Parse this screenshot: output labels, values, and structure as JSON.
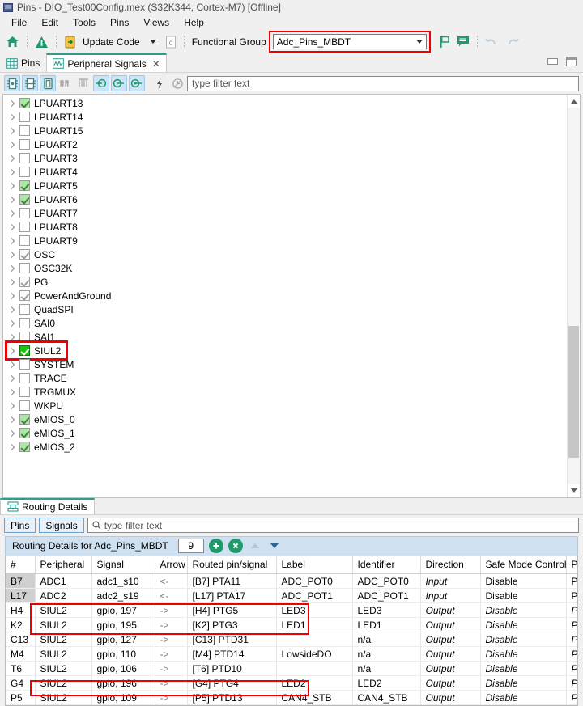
{
  "window": {
    "title": "Pins - DIO_Test00Config.mex (S32K344, Cortex-M7) [Offline]",
    "icon": "window-icon"
  },
  "menubar": {
    "items": [
      "File",
      "Edit",
      "Tools",
      "Pins",
      "Views",
      "Help"
    ]
  },
  "toolbar": {
    "home_icon": "home-icon",
    "warning_icon": "warning-icon",
    "update_code_icon": "update-code-icon",
    "update_code_label": "Update Code",
    "dropdown_caret": "chevron-down-icon",
    "config_icon": "config-c-icon",
    "functional_group_label": "Functional Group",
    "functional_group_value": "Adc_Pins_MBDT",
    "functional_group_arrow": "chevron-down-icon",
    "flag_icon": "flag-icon",
    "note_icon": "note-icon",
    "undo_icon": "undo-icon",
    "redo_icon": "redo-icon",
    "highlight_color": "#ee0000"
  },
  "editor": {
    "tabs": [
      {
        "label": "Pins",
        "icon": "grid-icon",
        "active": false,
        "closable": false
      },
      {
        "label": "Peripheral Signals",
        "icon": "wave-icon",
        "active": true,
        "closable": true
      }
    ],
    "close_glyph": "✕",
    "window_buttons": [
      "minimize-button",
      "maximize-button"
    ]
  },
  "filterbar": {
    "buttons": [
      {
        "name": "show-package-pins-icon",
        "active": true
      },
      {
        "name": "show-chip-pins-icon",
        "active": true
      },
      {
        "name": "show-dip-pins-icon",
        "active": true
      },
      {
        "name": "show-all-signals-icon",
        "active": false
      },
      {
        "name": "show-grouped-signals-icon",
        "active": false
      },
      {
        "name": "routed-in-icon",
        "active": true
      },
      {
        "name": "routed-out-icon",
        "active": true
      },
      {
        "name": "routed-bidir-icon",
        "active": true
      },
      {
        "name": "power-icon",
        "active": false
      },
      {
        "name": "clock-icon",
        "active": false
      }
    ],
    "filter_placeholder": "type filter text"
  },
  "tree": {
    "highlight_color": "#ee0000",
    "highlighted_item": "SIUL2",
    "items": [
      {
        "label": "LPUART13",
        "state": "pale-checked"
      },
      {
        "label": "LPUART14",
        "state": "unchecked"
      },
      {
        "label": "LPUART15",
        "state": "unchecked"
      },
      {
        "label": "LPUART2",
        "state": "unchecked"
      },
      {
        "label": "LPUART3",
        "state": "unchecked"
      },
      {
        "label": "LPUART4",
        "state": "unchecked"
      },
      {
        "label": "LPUART5",
        "state": "pale-checked"
      },
      {
        "label": "LPUART6",
        "state": "pale-checked"
      },
      {
        "label": "LPUART7",
        "state": "unchecked"
      },
      {
        "label": "LPUART8",
        "state": "unchecked"
      },
      {
        "label": "LPUART9",
        "state": "unchecked"
      },
      {
        "label": "OSC",
        "state": "gray-checked"
      },
      {
        "label": "OSC32K",
        "state": "unchecked"
      },
      {
        "label": "PG",
        "state": "gray-checked"
      },
      {
        "label": "PowerAndGround",
        "state": "gray-checked"
      },
      {
        "label": "QuadSPI",
        "state": "unchecked"
      },
      {
        "label": "SAI0",
        "state": "unchecked"
      },
      {
        "label": "SAI1",
        "state": "unchecked"
      },
      {
        "label": "SIUL2",
        "state": "bright-checked"
      },
      {
        "label": "SYSTEM",
        "state": "unchecked"
      },
      {
        "label": "TRACE",
        "state": "unchecked"
      },
      {
        "label": "TRGMUX",
        "state": "unchecked"
      },
      {
        "label": "WKPU",
        "state": "unchecked"
      },
      {
        "label": "eMIOS_0",
        "state": "pale-checked"
      },
      {
        "label": "eMIOS_1",
        "state": "pale-checked"
      },
      {
        "label": "eMIOS_2",
        "state": "pale-checked"
      }
    ]
  },
  "routing": {
    "tab_label": "Routing Details",
    "tab_icon": "routing-icon",
    "pins_button": "Pins",
    "signals_button": "Signals",
    "filter_placeholder": "type filter text",
    "search_icon": "search-icon",
    "header_title": "Routing Details for Adc_Pins_MBDT",
    "count": "9",
    "add_icon": "add-icon",
    "delete_icon": "delete-icon",
    "move_up_icon": "chevron-up-icon",
    "move_down_icon": "chevron-down-icon",
    "highlight_color": "#ee0000",
    "columns": [
      "#",
      "Peripheral",
      "Signal",
      "Arrow",
      "Routed pin/signal",
      "Label",
      "Identifier",
      "Direction",
      "Safe Mode Control",
      "Pull"
    ],
    "rows": [
      {
        "idx": "B7",
        "peripheral": "ADC1",
        "signal": "adc1_s10",
        "arrow": "<-",
        "routed": "[B7] PTA11",
        "label": "ADC_POT0",
        "identifier": "ADC_POT0",
        "direction": "Input",
        "safe": "Disable",
        "pull": "Pull",
        "system": true,
        "italic": false,
        "highlighted": false
      },
      {
        "idx": "L17",
        "peripheral": "ADC2",
        "signal": "adc2_s19",
        "arrow": "<-",
        "routed": "[L17] PTA17",
        "label": "ADC_POT1",
        "identifier": "ADC_POT1",
        "direction": "Input",
        "safe": "Disable",
        "pull": "Pull",
        "system": true,
        "italic": false,
        "highlighted": false
      },
      {
        "idx": "H4",
        "peripheral": "SIUL2",
        "signal": "gpio, 197",
        "arrow": "->",
        "routed": "[H4] PTG5",
        "label": "LED3",
        "identifier": "LED3",
        "direction": "Output",
        "safe": "Disable",
        "pull": "Pull",
        "system": false,
        "italic": true,
        "highlighted": true
      },
      {
        "idx": "K2",
        "peripheral": "SIUL2",
        "signal": "gpio, 195",
        "arrow": "->",
        "routed": "[K2] PTG3",
        "label": "LED1",
        "identifier": "LED1",
        "direction": "Output",
        "safe": "Disable",
        "pull": "Pull",
        "system": false,
        "italic": true,
        "highlighted": true
      },
      {
        "idx": "C13",
        "peripheral": "SIUL2",
        "signal": "gpio, 127",
        "arrow": "->",
        "routed": "[C13] PTD31",
        "label": "",
        "identifier": "n/a",
        "direction": "Output",
        "safe": "Disable",
        "pull": "Pull",
        "system": false,
        "italic": true,
        "highlighted": false
      },
      {
        "idx": "M4",
        "peripheral": "SIUL2",
        "signal": "gpio, 110",
        "arrow": "->",
        "routed": "[M4] PTD14",
        "label": "LowsideDO",
        "identifier": "n/a",
        "direction": "Output",
        "safe": "Disable",
        "pull": "Pull",
        "system": false,
        "italic": true,
        "highlighted": false
      },
      {
        "idx": "T6",
        "peripheral": "SIUL2",
        "signal": "gpio, 106",
        "arrow": "->",
        "routed": "[T6] PTD10",
        "label": "",
        "identifier": "n/a",
        "direction": "Output",
        "safe": "Disable",
        "pull": "Pull",
        "system": false,
        "italic": true,
        "highlighted": false
      },
      {
        "idx": "G4",
        "peripheral": "SIUL2",
        "signal": "gpio, 196",
        "arrow": "->",
        "routed": "[G4] PTG4",
        "label": "LED2",
        "identifier": "LED2",
        "direction": "Output",
        "safe": "Disable",
        "pull": "Pull",
        "system": false,
        "italic": true,
        "highlighted": true
      },
      {
        "idx": "P5",
        "peripheral": "SIUL2",
        "signal": "gpio, 109",
        "arrow": "->",
        "routed": "[P5] PTD13",
        "label": "CAN4_STB",
        "identifier": "CAN4_STB",
        "direction": "Output",
        "safe": "Disable",
        "pull": "Pull",
        "system": false,
        "italic": true,
        "highlighted": false
      }
    ]
  }
}
